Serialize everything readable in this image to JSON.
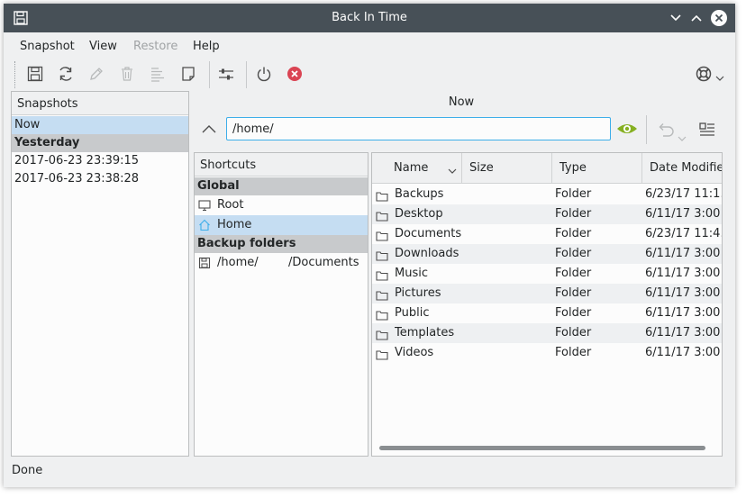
{
  "window": {
    "title": "Back In Time"
  },
  "menu": {
    "items": [
      {
        "label": "Snapshot",
        "enabled": true
      },
      {
        "label": "View",
        "enabled": true
      },
      {
        "label": "Restore",
        "enabled": false
      },
      {
        "label": "Help",
        "enabled": true
      }
    ]
  },
  "toolbar": {
    "buttons": [
      "save-icon",
      "refresh-icon",
      "edit-icon",
      "trash-icon",
      "log-icon",
      "note-icon",
      "settings-sliders-icon",
      "power-icon",
      "exit-icon",
      "lifebuoy-icon"
    ]
  },
  "snapshots": {
    "header": "Snapshots",
    "now": "Now",
    "group_yesterday": "Yesterday",
    "items": [
      "2017-06-23 23:39:15",
      "2017-06-23 23:38:28"
    ]
  },
  "browser": {
    "current_label": "Now",
    "path": "/home/"
  },
  "shortcuts": {
    "header": "Shortcuts",
    "group_global": "Global",
    "root": "Root",
    "home": "Home",
    "group_backup": "Backup folders",
    "backup_path": "/home/",
    "backup_sub": "/Documents"
  },
  "files": {
    "columns": {
      "name": "Name",
      "size": "Size",
      "type": "Type",
      "date": "Date Modified"
    },
    "rows": [
      {
        "name": "Backups",
        "size": "",
        "type": "Folder",
        "date": "6/23/17 11:1..."
      },
      {
        "name": "Desktop",
        "size": "",
        "type": "Folder",
        "date": "6/11/17 3:00 ..."
      },
      {
        "name": "Documents",
        "size": "",
        "type": "Folder",
        "date": "6/23/17 11:4..."
      },
      {
        "name": "Downloads",
        "size": "",
        "type": "Folder",
        "date": "6/11/17 3:00 ..."
      },
      {
        "name": "Music",
        "size": "",
        "type": "Folder",
        "date": "6/11/17 3:00 ..."
      },
      {
        "name": "Pictures",
        "size": "",
        "type": "Folder",
        "date": "6/11/17 3:00 ..."
      },
      {
        "name": "Public",
        "size": "",
        "type": "Folder",
        "date": "6/11/17 3:00 ..."
      },
      {
        "name": "Templates",
        "size": "",
        "type": "Folder",
        "date": "6/11/17 3:00 ..."
      },
      {
        "name": "Videos",
        "size": "",
        "type": "Folder",
        "date": "6/11/17 3:00 ..."
      }
    ]
  },
  "status": {
    "text": "Done"
  },
  "colors": {
    "titlebar": "#475057",
    "selection": "#c5ddf2",
    "accent": "#3daee9",
    "exit_red": "#da4453",
    "eye_green": "#86b022"
  }
}
